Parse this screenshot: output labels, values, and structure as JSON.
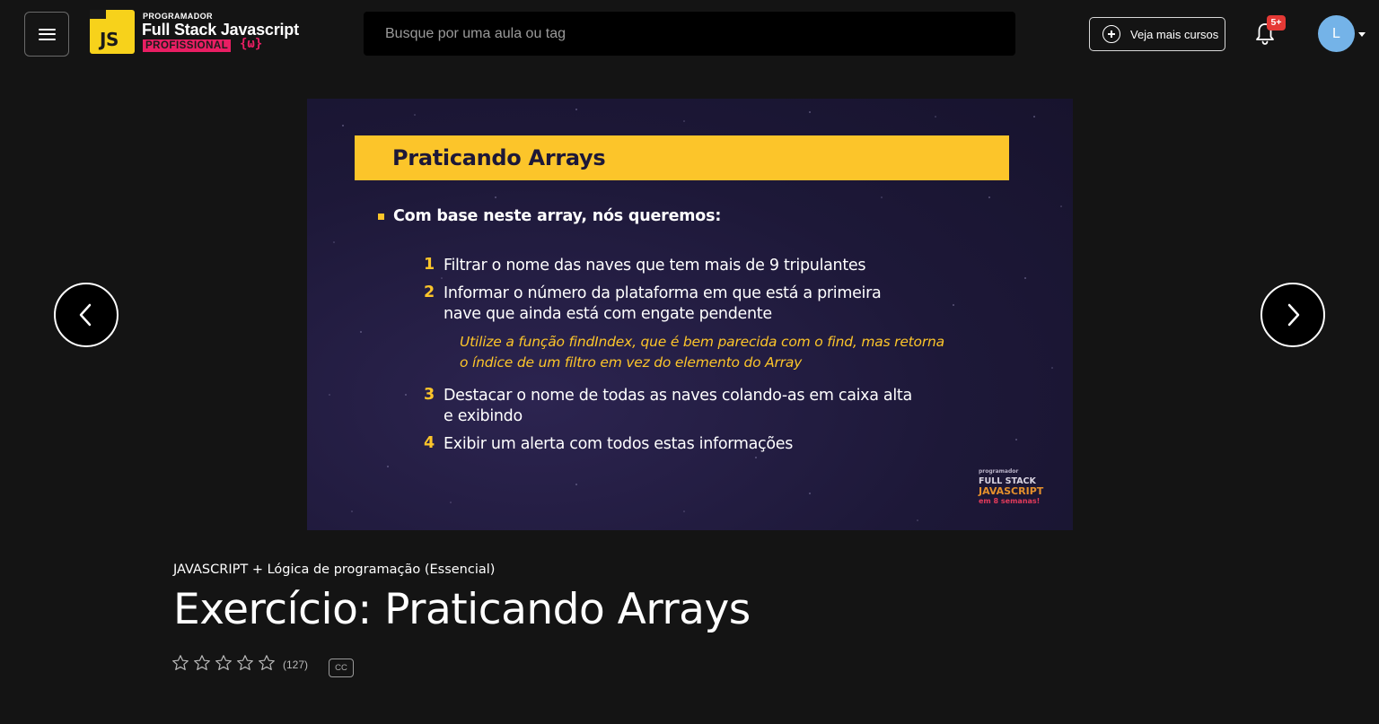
{
  "header": {
    "menu_icon": "hamburger-icon",
    "logo": {
      "js_text": "JS",
      "small_text": "PROGRAMADOR",
      "main_text": "Full Stack Javascript",
      "pro_text": "PROFISSIONAL",
      "braces_text": "{ω}"
    },
    "search_placeholder": "Busque por uma aula ou tag",
    "search_value": "",
    "more_courses_label": "Veja mais cursos",
    "more_courses_icon": "plus-circle-icon",
    "notifications_badge": "5+",
    "notifications_icon": "bell-icon",
    "avatar_initial": "L"
  },
  "video": {
    "slide_title": "Praticando Arrays",
    "intro": "Com base neste array, nós queremos:",
    "items": [
      {
        "num": "1",
        "line1": "Filtrar o nome das naves que tem mais de 9 tripulantes",
        "line2": ""
      },
      {
        "num": "2",
        "line1": "Informar o número da plataforma em que está a primeira",
        "line2": "nave que ainda está com engate pendente"
      },
      {
        "num": "3",
        "line1": "Destacar o nome de todas as naves colando-as em caixa alta",
        "line2": "e exibindo"
      },
      {
        "num": "4",
        "line1": "Exibir um alerta com todos estas informações",
        "line2": ""
      }
    ],
    "note_line1": "Utilize a função findIndex, que é bem parecida com o find, mas retorna",
    "note_line2": "o índice de um filtro em vez do elemento do Array",
    "watermark": {
      "line1": "programador",
      "line2": "FULL STACK",
      "line3": "JAVASCRIPT",
      "line4": "em 8 semanas!"
    }
  },
  "nav": {
    "prev_icon": "chevron-left-icon",
    "next_icon": "chevron-right-icon"
  },
  "lesson": {
    "course_name": "JAVASCRIPT + Lógica de programação (Essencial)",
    "title": "Exercício: Praticando Arrays",
    "rating_stars": 0,
    "rating_max": 5,
    "rating_count": "(127)",
    "cc_label": "CC"
  },
  "colors": {
    "background": "#141414",
    "slide_background": "#1d1838",
    "slide_accent": "#fcc52a",
    "logo_yellow": "#f7d21b",
    "logo_pink": "#e91e63",
    "badge_red": "#e53935",
    "avatar_blue": "#74b3e8"
  }
}
